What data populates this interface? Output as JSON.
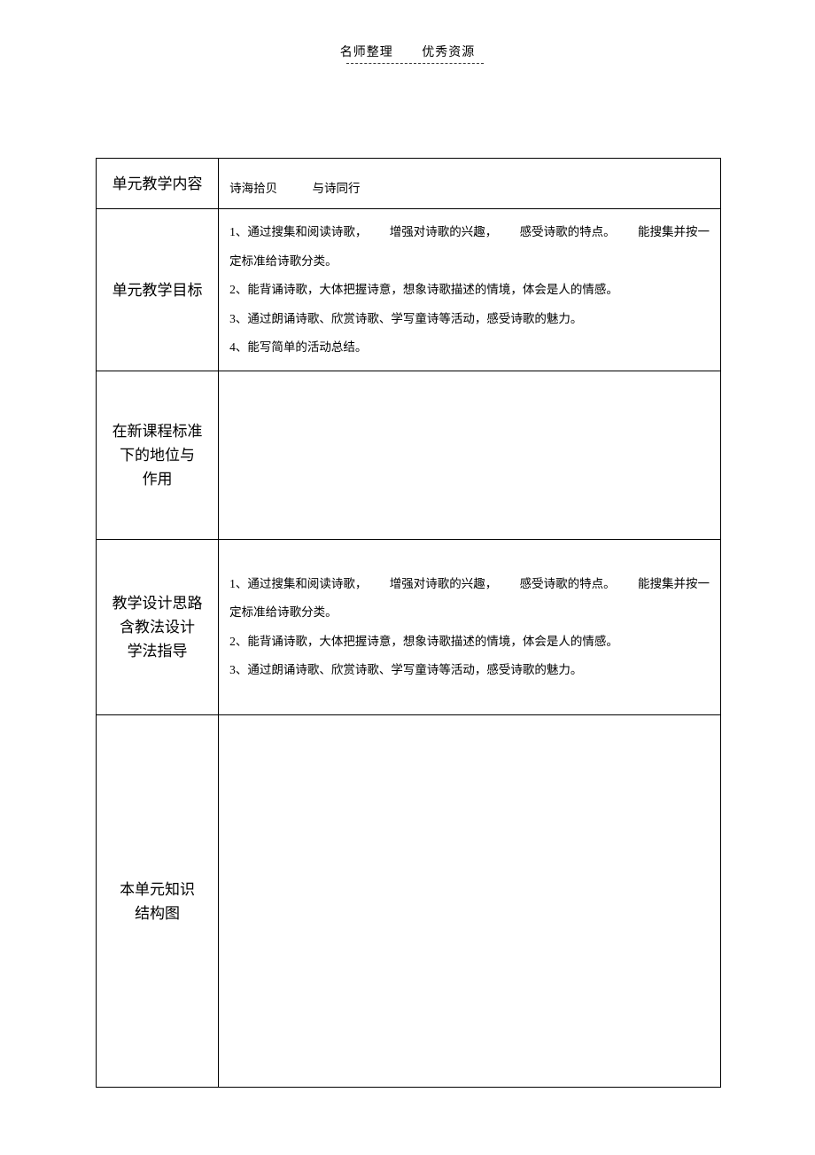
{
  "header": {
    "left": "名师整理",
    "right": "优秀资源"
  },
  "rows": {
    "r1": {
      "label": "单元教学内容",
      "content_a": "诗海拾贝",
      "content_b": "与诗同行"
    },
    "r2": {
      "label": "单元教学目标",
      "line1_a": "1、通过搜集和阅读诗歌，",
      "line1_b": "增强对诗歌的兴趣，",
      "line1_c": "感受诗歌的特点。",
      "line1_d": "能搜集并按一",
      "line2": "定标准给诗歌分类。",
      "line3": "2、能背诵诗歌，大体把握诗意，想象诗歌描述的情境，体会是人的情感。",
      "line4": "3、通过朗诵诗歌、欣赏诗歌、学写童诗等活动，感受诗歌的魅力。",
      "line5": "4、能写简单的活动总结。"
    },
    "r3": {
      "label_l1": "在新课程标准",
      "label_l2": "下的地位与",
      "label_l3": "作用"
    },
    "r4": {
      "label_l1": "教学设计思路",
      "label_l2": "含教法设计",
      "label_l3": "学法指导",
      "line1_a": "1、通过搜集和阅读诗歌，",
      "line1_b": "增强对诗歌的兴趣，",
      "line1_c": "感受诗歌的特点。",
      "line1_d": "能搜集并按一",
      "line2": "定标准给诗歌分类。",
      "line3": "2、能背诵诗歌，大体把握诗意，想象诗歌描述的情境，体会是人的情感。",
      "line4": "3、通过朗诵诗歌、欣赏诗歌、学写童诗等活动，感受诗歌的魅力。"
    },
    "r5": {
      "label_l1": "本单元知识",
      "label_l2": "结构图"
    }
  }
}
